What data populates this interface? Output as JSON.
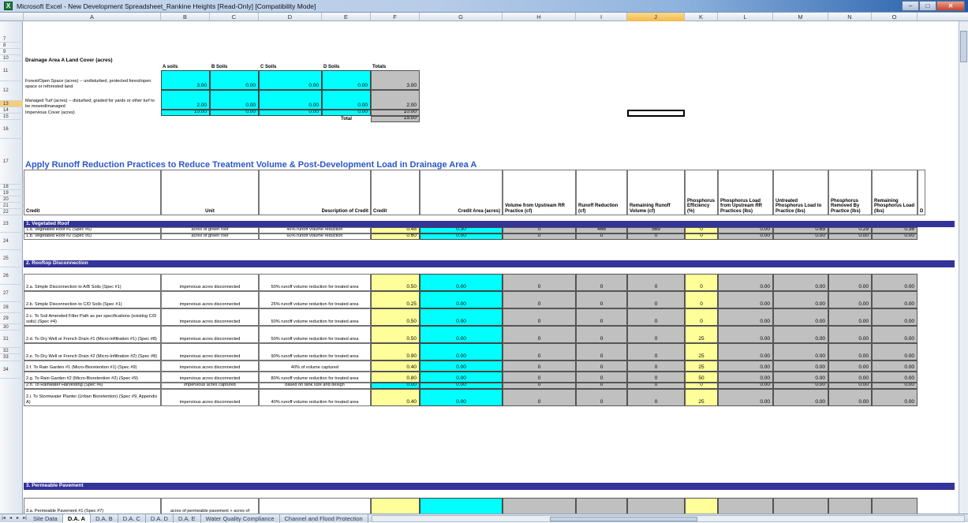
{
  "window": {
    "title": "Microsoft Excel - New Development Spreadsheet_Rankine Heights  [Read-Only]  [Compatibility Mode]",
    "min": "–",
    "max": "□",
    "close": "✕"
  },
  "columns": [
    "A",
    "B",
    "C",
    "D",
    "E",
    "F",
    "G",
    "H",
    "I",
    "J",
    "K",
    "L",
    "M",
    "N",
    "O"
  ],
  "rows": [
    "7",
    "8",
    "9",
    "10",
    "11",
    "12",
    "13",
    "14",
    "15",
    "16",
    "17",
    "18",
    "19",
    "20",
    "21",
    "22",
    "23",
    "24",
    "25",
    "26",
    "27",
    "28",
    "29",
    "30",
    "31",
    "32",
    "33",
    "34"
  ],
  "landcover": {
    "title": "Drainage Area A Land Cover (acres)",
    "headers": [
      "A soils",
      "B Soils",
      "C Soils",
      "D Soils",
      "Totals"
    ],
    "r11_label": "Forest/Open Space (acres) -- undisturbed, protected forest/open space or reforested land",
    "r11": [
      "3.00",
      "0.00",
      "0.00",
      "0.00",
      "3.00"
    ],
    "r12_label": "Managed Turf (acres) -- disturbed, graded for yards or other turf to be mowed/managed",
    "r12": [
      "2.00",
      "0.00",
      "0.00",
      "0.00",
      "2.00"
    ],
    "r13_label": "Impervious Cover (acres)",
    "r13": [
      "10.00",
      "0.00",
      "0.00",
      "0.00",
      "10.00"
    ],
    "total_label": "Total",
    "total": "15.00"
  },
  "section_title": "Apply Runoff Reduction Practices to Reduce Treatment Volume & Post-Development Load in Drainage Area A",
  "hdr17": {
    "a": "Credit",
    "b": "Unit",
    "d": "Description of Credit",
    "f": "Credit",
    "g": "Credit Area (acres)",
    "h": "Volume from Upstream RR Practice (cf)",
    "i": "Runoff Reduction (cf)",
    "j": "Remaining Runoff Volume (cf)",
    "k": "Phosphorus Efficiency (%)",
    "l": "Phosphorus Load from Upstream RR Practices (lbs)",
    "m": "Untreated Phosphorus Load to Practice (lbs)",
    "n": "Phosphorus Removed By Practice (lbs)",
    "o": "Remaining Phosphorus Load (lbs)",
    "p": "D"
  },
  "sec1": "1. Vegetated Roof",
  "sec2": "2. Rooftop Disconnection",
  "sec3": "3. Permeable Pavement",
  "r19": {
    "a": "1.a. Vegetated Roof #1 (Spec #5)",
    "b": "acres of green roof",
    "d": "45% runoff volume reduction",
    "f": "0.45",
    "g": "0.30",
    "h": "0",
    "i": "466",
    "j": "569",
    "k": "0",
    "l": "0.00",
    "m": "0.65",
    "n": "0.29",
    "o": "0.36"
  },
  "r20": {
    "a": "1.b. Vegetated Roof #2 (Spec #5)",
    "b": "acres of green roof",
    "d": "60% runoff volume reduction",
    "f": "0.60",
    "g": "0.00",
    "h": "0",
    "i": "0",
    "j": "0",
    "k": "0",
    "l": "0.00",
    "m": "0.00",
    "n": "0.00",
    "o": "0.00"
  },
  "r23": {
    "a": "2.a. Simple Disconnection to A/B Soils (Spec #1)",
    "b": "impervious acres disconnected",
    "d": "50% runoff volume reduction for treated area",
    "f": "0.50",
    "g": "0.00",
    "h": "0",
    "i": "0",
    "j": "0",
    "k": "0",
    "l": "0.00",
    "m": "0.00",
    "n": "0.00",
    "o": "0.00"
  },
  "r24": {
    "a": "2.b. Simple Disconnection to C/D Soils (Spec #1)",
    "b": "impervious acres disconnected",
    "d": "25% runoff volume reduction for treated area",
    "f": "0.25",
    "g": "0.00",
    "h": "0",
    "i": "0",
    "j": "0",
    "k": "0",
    "l": "0.00",
    "m": "0.00",
    "n": "0.00",
    "o": "0.00"
  },
  "r25": {
    "a": "2.c. To Soil Amended Filter Path as per specifications (existing C/D soils) (Spec #4)",
    "b": "impervious acres disconnected",
    "d": "50% runoff volume reduction for treated area",
    "f": "0.50",
    "g": "0.00",
    "h": "0",
    "i": "0",
    "j": "0",
    "k": "0",
    "l": "0.00",
    "m": "0.00",
    "n": "0.00",
    "o": "0.00"
  },
  "r26": {
    "a": "2.d. To Dry Well or French Drain #1 (Micro-infiltration #1) (Spec #8)",
    "b": "impervious acres disconnected",
    "d": "50% runoff volume reduction for treated area",
    "f": "0.50",
    "g": "0.00",
    "h": "0",
    "i": "0",
    "j": "0",
    "k": "25",
    "l": "0.00",
    "m": "0.00",
    "n": "0.00",
    "o": "0.00"
  },
  "r27": {
    "a": "2.e. To Dry Well or French Drain #2 (Micro-Infiltration #2) (Spec #8)",
    "b": "impervious acres disconnected",
    "d": "90% runoff volume reduction for treated area",
    "f": "0.90",
    "g": "0.00",
    "h": "0",
    "i": "0",
    "j": "0",
    "k": "25",
    "l": "0.00",
    "m": "0.00",
    "n": "0.00",
    "o": "0.00"
  },
  "r28": {
    "a": "2.f. To Rain Garden #1 (Micro-Bioretention #1) (Spec #9)",
    "b": "impervious acres disconnected",
    "d": "40% of volume captured",
    "f": "0.40",
    "g": "0.00",
    "h": "0",
    "i": "0",
    "j": "0",
    "k": "25",
    "l": "0.00",
    "m": "0.00",
    "n": "0.00",
    "o": "0.00"
  },
  "r29": {
    "a": "2.g. To Rain Garden #2 (Micro-Bioretention #2) (Spec #9)",
    "b": "impervious acres disconnected",
    "d": "80% runoff volume reduction for treated area",
    "f": "0.80",
    "g": "0.00",
    "h": "0",
    "i": "0",
    "j": "0",
    "k": "50",
    "l": "0.00",
    "m": "0.00",
    "n": "0.00",
    "o": "0.00"
  },
  "r30": {
    "a": "2.h. To Rainwater Harvesting (Spec #6)",
    "b": "impervious acres captured",
    "d": "based on tank size and design",
    "f": "0.00",
    "g": "0.00",
    "h": "0",
    "i": "0",
    "j": "0",
    "k": "0",
    "l": "0.00",
    "m": "0.00",
    "n": "0.00",
    "o": "0.00"
  },
  "r31": {
    "a": "2.i. To Stormwater Planter (Urban Bioretention) (Spec #9, Appendix A)",
    "b": "impervious acres disconnected",
    "d": "40% runoff volume reduction for treated area",
    "f": "0.40",
    "g": "0.00",
    "h": "0",
    "i": "0",
    "j": "0",
    "k": "25",
    "l": "0.00",
    "m": "0.00",
    "n": "0.00",
    "o": "0.00"
  },
  "r34": {
    "a": "3.a. Permeable Pavement #1 (Spec #7)",
    "b": "acres of permeable pavement + acres of"
  },
  "sheets": [
    "Site Data",
    "D.A. A",
    "D.A. B",
    "D.A. C",
    "D.A. D",
    "D.A. E",
    "Water Quality Compliance",
    "Channel and Flood Protection"
  ],
  "nav": [
    "|◂",
    "◂",
    "▸",
    "▸|"
  ]
}
